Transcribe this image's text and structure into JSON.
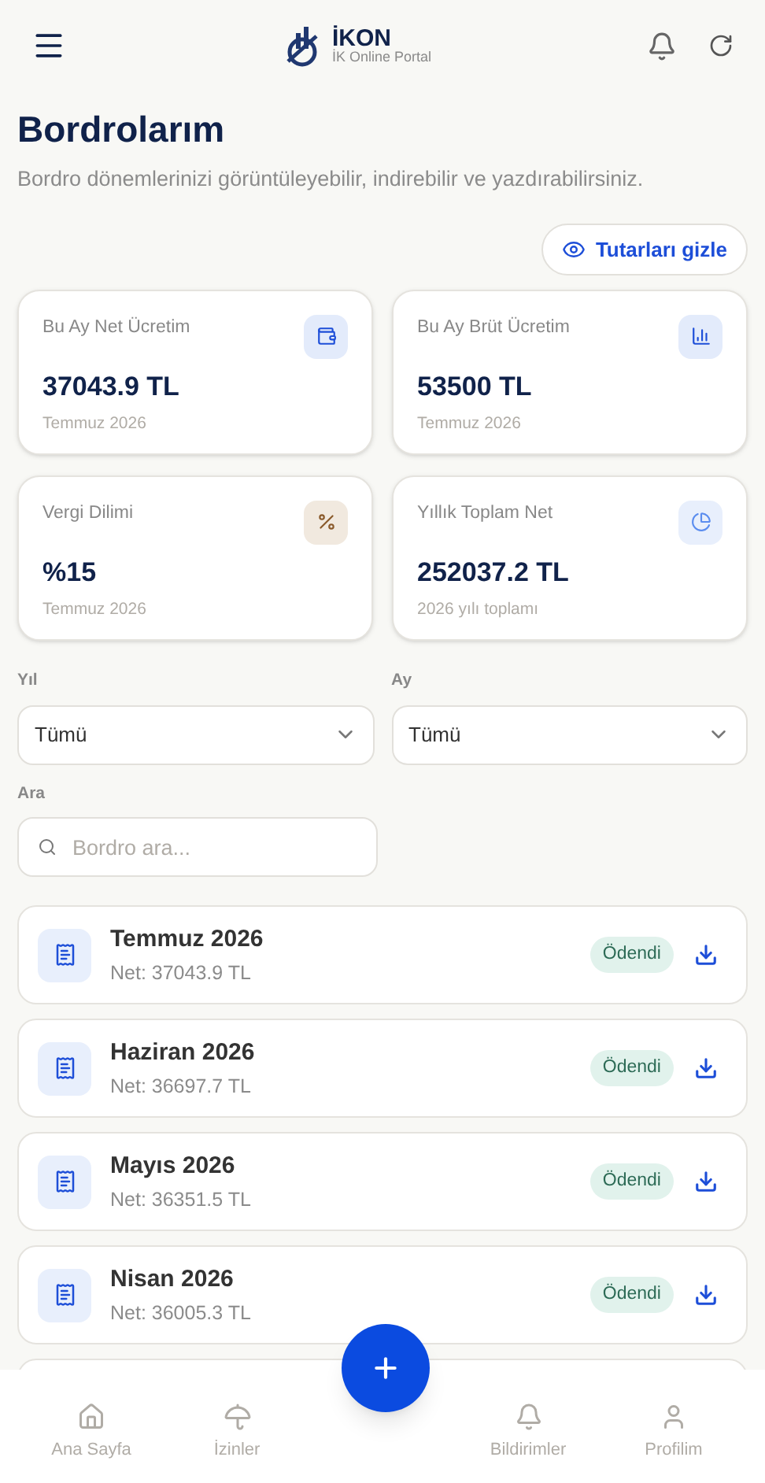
{
  "header": {
    "logo_title": "İKON",
    "logo_subtitle": "İK Online Portal"
  },
  "page": {
    "title": "Bordrolarım",
    "subtitle": "Bordro dönemlerinizi görüntüleyebilir, indirebilir ve yazdırabilirsiniz.",
    "toggle_button": "Tutarları gizle"
  },
  "stats": [
    {
      "label": "Bu Ay Net Ücretim",
      "value": "37043.9 TL",
      "note": "Temmuz 2026",
      "kind": "wallet"
    },
    {
      "label": "Bu Ay Brüt Ücretim",
      "value": "53500 TL",
      "note": "Temmuz 2026",
      "kind": "chart"
    },
    {
      "label": "Vergi Dilimi",
      "value": "%15",
      "note": "Temmuz 2026",
      "kind": "percent"
    },
    {
      "label": "Yıllık Toplam Net",
      "value": "252037.2 TL",
      "note": "2026 yılı toplamı",
      "kind": "pie"
    }
  ],
  "filters": {
    "year": {
      "label": "Yıl",
      "value": "Tümü"
    },
    "month": {
      "label": "Ay",
      "value": "Tümü"
    },
    "search": {
      "label": "Ara",
      "placeholder": "Bordro ara..."
    }
  },
  "payslips": [
    {
      "period": "Temmuz 2026",
      "net": "Net: 37043.9 TL",
      "status": "Ödendi"
    },
    {
      "period": "Haziran 2026",
      "net": "Net: 36697.7 TL",
      "status": "Ödendi"
    },
    {
      "period": "Mayıs 2026",
      "net": "Net: 36351.5 TL",
      "status": "Ödendi"
    },
    {
      "period": "Nisan 2026",
      "net": "Net: 36005.3 TL",
      "status": "Ödendi"
    }
  ],
  "bottom_nav": [
    {
      "label": "Ana Sayfa",
      "kind": "home",
      "selected": false
    },
    {
      "label": "İzinler",
      "kind": "leave",
      "selected": false
    },
    {
      "label": "Bildirimler",
      "kind": "bell",
      "selected": false
    },
    {
      "label": "Profilim",
      "kind": "user",
      "selected": false
    }
  ]
}
